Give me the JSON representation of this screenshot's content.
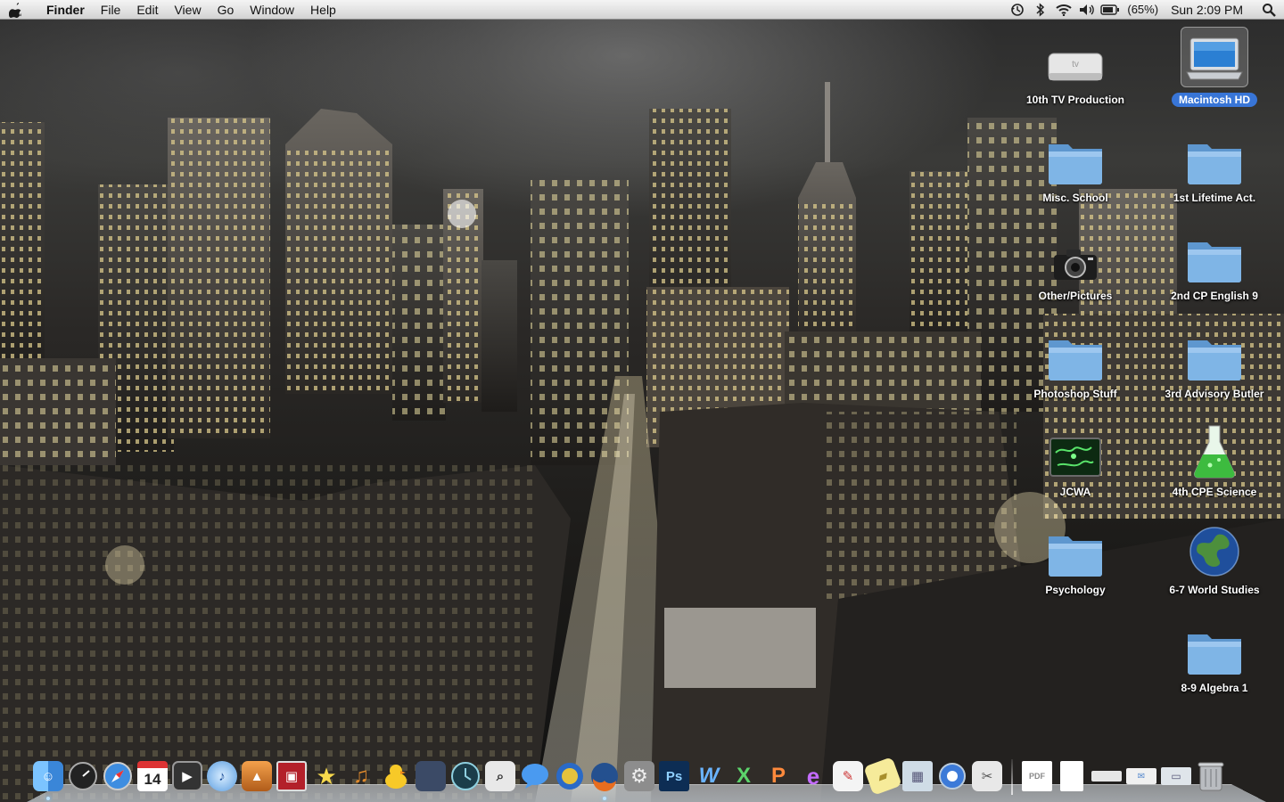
{
  "menubar": {
    "app_name": "Finder",
    "menus": [
      "File",
      "Edit",
      "View",
      "Go",
      "Window",
      "Help"
    ],
    "battery_percent": "(65%)",
    "clock": "Sun 2:09 PM"
  },
  "desktop_icons": [
    {
      "label": "10th TV Production",
      "icon": "appletv-icon",
      "selected": false
    },
    {
      "label": "Macintosh HD",
      "icon": "hard-drive-icon",
      "selected": true
    },
    {
      "label": "Misc. School",
      "icon": "folder-icon",
      "selected": false
    },
    {
      "label": "1st Lifetime Act.",
      "icon": "folder-icon",
      "selected": false
    },
    {
      "label": "Other/Pictures",
      "icon": "camera-icon",
      "selected": false
    },
    {
      "label": "2nd CP English 9",
      "icon": "folder-icon",
      "selected": false
    },
    {
      "label": "Photoshop Stuff",
      "icon": "folder-icon",
      "selected": false
    },
    {
      "label": "3rd Advisory Butler",
      "icon": "folder-icon",
      "selected": false
    },
    {
      "label": "JCWA",
      "icon": "map-icon",
      "selected": false
    },
    {
      "label": "4th CPE Science",
      "icon": "flask-icon",
      "selected": false
    },
    {
      "label": "Psychology",
      "icon": "folder-icon",
      "selected": false
    },
    {
      "label": "6-7 World Studies",
      "icon": "globe-icon",
      "selected": false
    },
    {
      "label": "8-9 Algebra 1",
      "icon": "folder-icon",
      "selected": false
    }
  ],
  "dock": {
    "apps": [
      {
        "name": "finder-icon",
        "running": true
      },
      {
        "name": "dashboard-icon",
        "running": false
      },
      {
        "name": "safari-icon",
        "running": false
      },
      {
        "name": "ical-icon",
        "running": false,
        "text": "14"
      },
      {
        "name": "imovie-icon",
        "running": false
      },
      {
        "name": "itunes-icon",
        "running": false
      },
      {
        "name": "iphoto-icon",
        "running": false
      },
      {
        "name": "photo-booth-icon",
        "running": false
      },
      {
        "name": "imovie-star-icon",
        "running": false
      },
      {
        "name": "garageband-icon",
        "running": false
      },
      {
        "name": "adium-icon",
        "running": false
      },
      {
        "name": "spaces-icon",
        "running": false
      },
      {
        "name": "time-machine-icon",
        "running": false
      },
      {
        "name": "preview-icon",
        "running": false
      },
      {
        "name": "ichat-icon",
        "running": false
      },
      {
        "name": "world-of-warcraft-icon",
        "running": false
      },
      {
        "name": "firefox-icon",
        "running": true
      },
      {
        "name": "system-preferences-icon",
        "running": false
      },
      {
        "name": "photoshop-icon",
        "running": false,
        "text": "Ps"
      },
      {
        "name": "word-icon",
        "running": false,
        "text": "W"
      },
      {
        "name": "excel-icon",
        "running": false,
        "text": "X"
      },
      {
        "name": "powerpoint-icon",
        "running": false,
        "text": "P"
      },
      {
        "name": "entourage-icon",
        "running": false,
        "text": "e"
      },
      {
        "name": "textedit-icon",
        "running": false
      },
      {
        "name": "stickies-icon",
        "running": false
      },
      {
        "name": "app-store-folder-icon",
        "running": false
      },
      {
        "name": "quicktime-icon",
        "running": false
      },
      {
        "name": "script-editor-icon",
        "running": false
      }
    ],
    "docs": [
      {
        "name": "pdf-document-icon"
      },
      {
        "name": "document-icon"
      },
      {
        "name": "stack-icon"
      },
      {
        "name": "mail-stack-icon"
      },
      {
        "name": "downloads-stack-icon"
      },
      {
        "name": "trash-icon"
      }
    ]
  },
  "colors": {
    "folder_blue": "#7fb5e6",
    "selection_blue": "#3875d7",
    "menubar_text": "#111111"
  }
}
